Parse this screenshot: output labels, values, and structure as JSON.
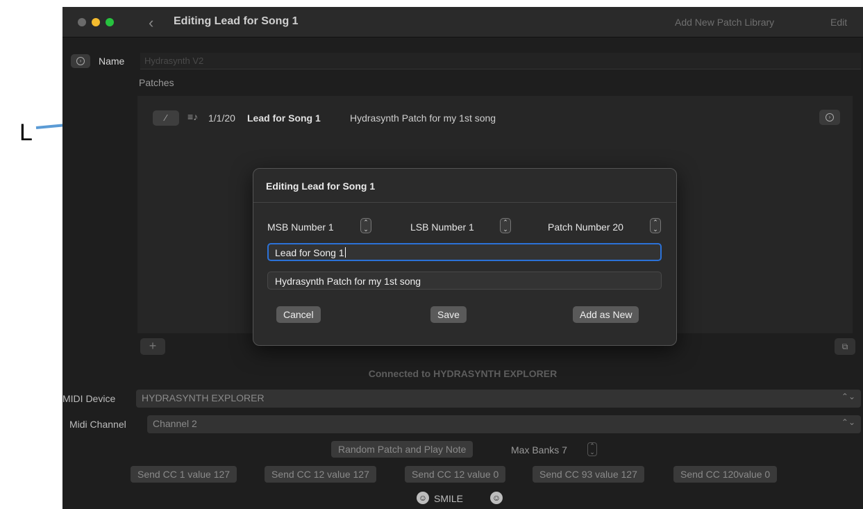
{
  "annotation": {
    "label": "L"
  },
  "window": {
    "title": "Editing Lead for Song 1",
    "toolbar": {
      "add_library": "Add New Patch Library",
      "edit": "Edit"
    }
  },
  "library": {
    "name_label": "Name",
    "name_value": "Hydrasynth V2",
    "patches_label": "Patches"
  },
  "patches": [
    {
      "number": "1/1/20",
      "name": "Lead for Song 1",
      "description": "Hydrasynth Patch for my 1st song"
    }
  ],
  "status": {
    "connected": "Connected to HYDRASYNTH EXPLORER"
  },
  "midi": {
    "device_label": "MIDI Device",
    "device_value": "HYDRASYNTH EXPLORER",
    "channel_label": "Midi Channel",
    "channel_value": "Channel 2"
  },
  "controls": {
    "random_patch": "Random Patch and Play Note",
    "max_banks_label": "Max Banks 7",
    "cc_buttons": [
      "Send CC 1 value 127",
      "Send CC 12 value 127",
      "Send CC 12 value 0",
      "Send CC 93 value 127",
      "Send CC 120value 0"
    ],
    "smile": "SMILE"
  },
  "dialog": {
    "title": "Editing Lead for Song 1",
    "msb_label": "MSB Number  1",
    "lsb_label": "LSB Number  1",
    "patch_label": "Patch Number 20",
    "name_value": "Lead for Song 1",
    "description_value": "Hydrasynth Patch for my 1st song",
    "cancel": "Cancel",
    "save": "Save",
    "add_new": "Add as New"
  }
}
